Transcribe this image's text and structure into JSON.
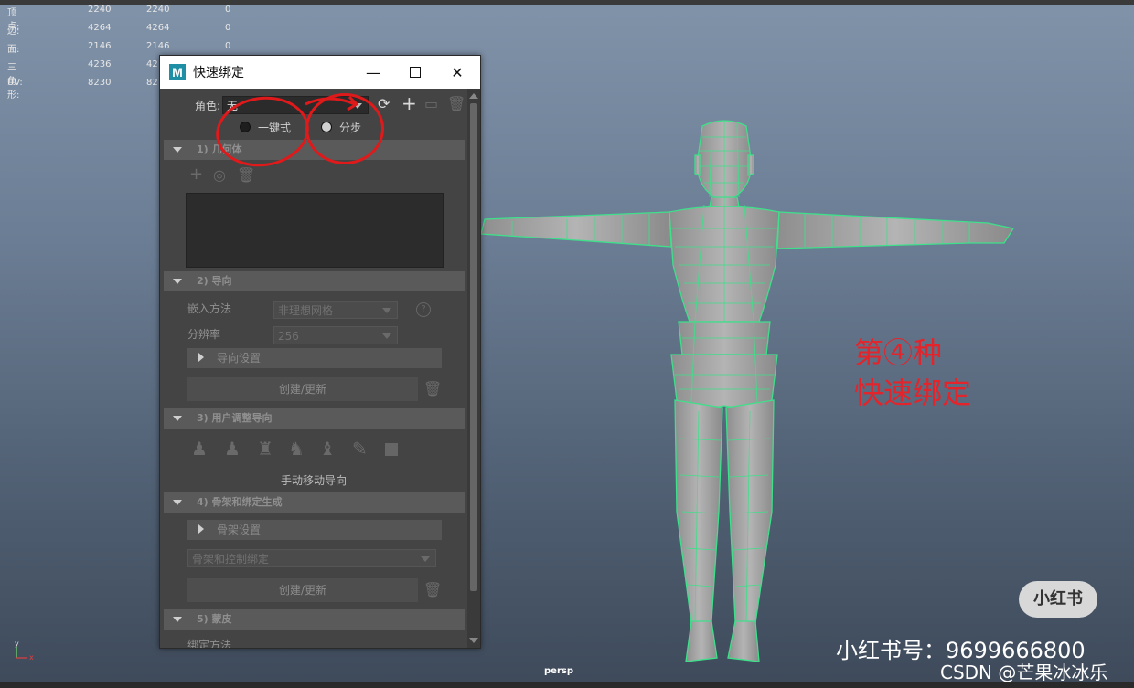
{
  "hud": {
    "rows": [
      {
        "label": "顶点:",
        "v1": "2240",
        "v2": "2240",
        "v3": "0"
      },
      {
        "label": "边:",
        "v1": "4264",
        "v2": "4264",
        "v3": "0"
      },
      {
        "label": "面:",
        "v1": "2146",
        "v2": "2146",
        "v3": "0"
      },
      {
        "label": "三角形:",
        "v1": "4236",
        "v2": "42",
        "v3": ""
      },
      {
        "label": "UV:",
        "v1": "8230",
        "v2": "82",
        "v3": ""
      }
    ]
  },
  "window": {
    "title": "快速绑定",
    "logo": "M",
    "min": "—",
    "close": "✕"
  },
  "role": {
    "label": "角色:",
    "value": "无"
  },
  "mode": {
    "oneclick": "一键式",
    "step": "分步",
    "selected": "step"
  },
  "sections": {
    "geometry": "1) 几何体",
    "guides": "2) 导向",
    "user_adjust": "3) 用户调整导向",
    "skeleton": "4) 骨架和绑定生成",
    "skinning": "5) 蒙皮"
  },
  "guides": {
    "embed_label": "嵌入方法",
    "embed_value": "非理想网格",
    "res_label": "分辨率",
    "res_value": "256",
    "settings": "导向设置",
    "create": "创建/更新",
    "help": "?"
  },
  "user_adjust": {
    "manual": "手动移动导向"
  },
  "skeleton": {
    "settings": "骨架设置",
    "mode_value": "骨架和控制绑定",
    "create": "创建/更新"
  },
  "skinning": {
    "bind_label": "绑定方法"
  },
  "viewport": {
    "camera": "persp",
    "axis_y": "y",
    "axis_x": "x"
  },
  "overlay": {
    "annotation_line1": "第④种",
    "annotation_line2": "快速绑定",
    "badge": "小红书",
    "watermark1": "小红书号：9699666800",
    "watermark2": "CSDN @芒果冰冰乐"
  },
  "colors": {
    "wireframe": "#3ee08a",
    "annotation": "#e3242b",
    "maya_logo": "#1f8fa6"
  }
}
